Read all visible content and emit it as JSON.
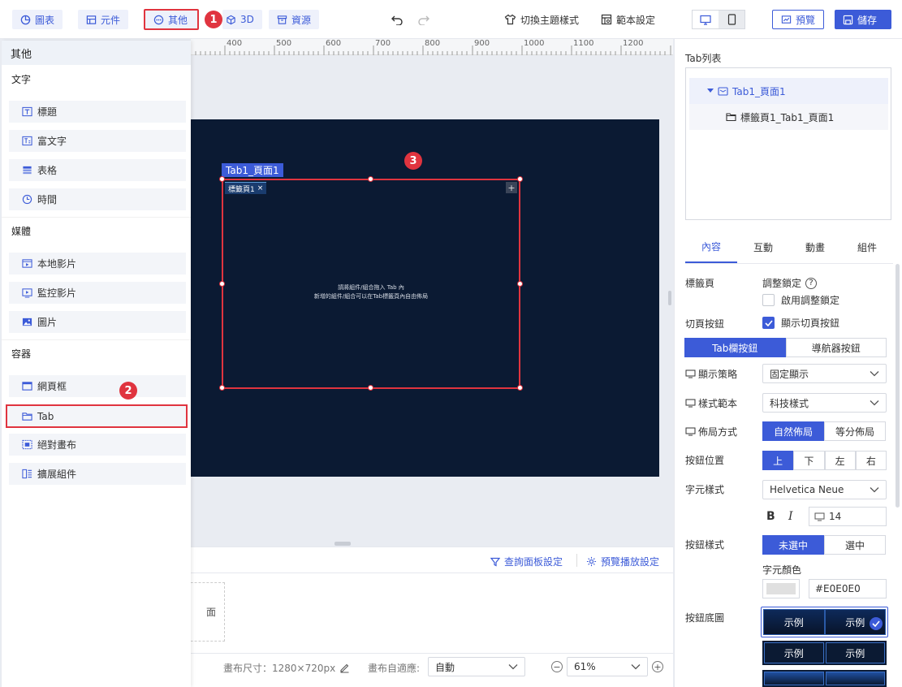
{
  "topbar": {
    "chart_btn": "圖表",
    "component_btn": "元件",
    "other_btn": "其他",
    "threed_btn": "3D",
    "resource_btn": "資源",
    "theme_btn": "切換主題樣式",
    "template_btn": "範本設定",
    "preview_btn": "預覽",
    "save_btn": "儲存"
  },
  "badges": {
    "one": "1",
    "two": "2",
    "three": "3"
  },
  "leftpanel": {
    "title": "其他",
    "sections": {
      "text": "文字",
      "media": "媒體",
      "container": "容器"
    },
    "items": {
      "title": "標題",
      "richtext": "富文字",
      "table": "表格",
      "time": "時間",
      "localvideo": "本地影片",
      "monitorvideo": "監控影片",
      "image": "圖片",
      "webframe": "網頁框",
      "tab": "Tab",
      "abscanvas": "絕對畫布",
      "extension": "擴展組件"
    }
  },
  "ruler": [
    "400",
    "500",
    "600",
    "700",
    "800",
    "900",
    "1000",
    "1100",
    "1200"
  ],
  "canvas": {
    "tab_name": "Tab1_頁面1",
    "tab_label": "標籤頁1",
    "hint_line1": "請將組件/組合拖入 Tab 內",
    "hint_line2": "新增的組件/組合可以在Tab標籤頁內自由佈局"
  },
  "bottom": {
    "query_panel": "查詢面板設定",
    "preview_play": "預覽播放設定",
    "card_text": "面",
    "canvas_size_label": "畫布尺寸：1280×720px",
    "fit_label": "畫布自適應:",
    "fit_value": "自動",
    "zoom_value": "61%"
  },
  "rightpanel": {
    "tablist_title": "Tab列表",
    "tree_parent": "Tab1_頁面1",
    "tree_child": "標籤頁1_Tab1_頁面1",
    "tabs": [
      "內容",
      "互動",
      "動畫",
      "組件"
    ],
    "tabpage_label": "標籤頁",
    "lock_label": "調整鎖定",
    "lock_enable": "啟用調整鎖定",
    "switch_label": "切頁按鈕",
    "show_switch": "顯示切頁按鈕",
    "tabbar_btn": "Tab欄按鈕",
    "nav_btn": "導航器按鈕",
    "display_strategy_label": "顯示策略",
    "display_strategy_value": "固定顯示",
    "style_template_label": "樣式範本",
    "style_template_value": "科技樣式",
    "layout_label": "佈局方式",
    "layout_natural": "自然佈局",
    "layout_equal": "等分佈局",
    "btn_position_label": "按鈕位置",
    "positions": [
      "上",
      "下",
      "左",
      "右"
    ],
    "font_style_label": "字元樣式",
    "font_value": "Helvetica Neue",
    "bold": "B",
    "italic": "I",
    "font_size": "14",
    "btn_style_label": "按鈕樣式",
    "unselected": "未選中",
    "selected": "選中",
    "font_color_label": "字元顏色",
    "font_color_value": "#E0E0E0",
    "btn_bg_label": "按鈕底圖",
    "example": "示例"
  },
  "colors": {
    "accent": "#3c5bd8",
    "red": "#e0343f",
    "canvas": "#0b1a33"
  }
}
